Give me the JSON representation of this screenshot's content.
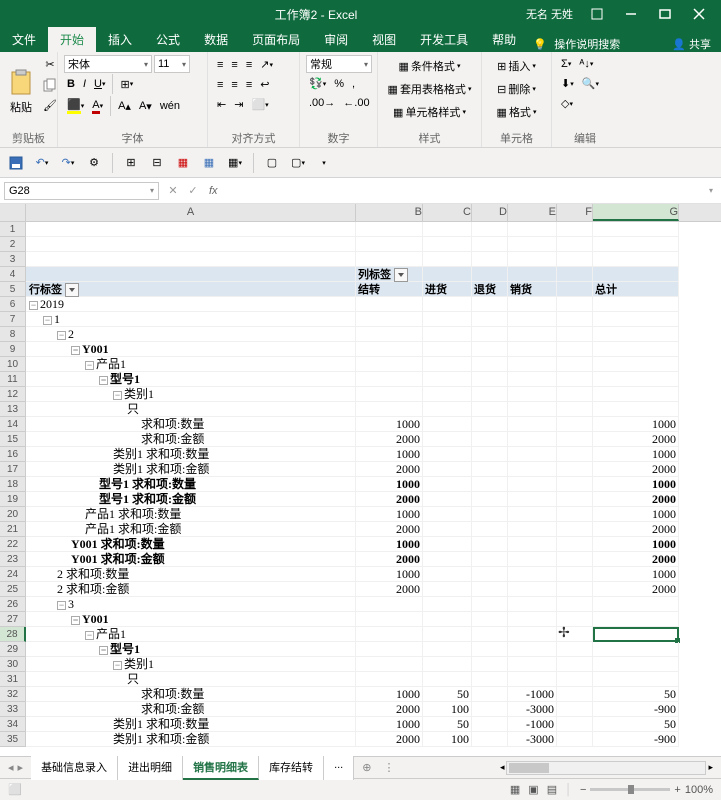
{
  "title": "工作簿2 - Excel",
  "user": "无名 无姓",
  "menu": {
    "file": "文件",
    "home": "开始",
    "insert": "插入",
    "formulas": "公式",
    "data": "数据",
    "pagelayout": "页面布局",
    "review": "审阅",
    "view": "视图",
    "developer": "开发工具",
    "help": "帮助",
    "tellme": "操作说明搜索",
    "share": "共享"
  },
  "ribbon": {
    "clipboard": {
      "label": "剪贴板",
      "paste": "粘贴"
    },
    "font": {
      "label": "字体",
      "name": "宋体",
      "size": "11"
    },
    "align": {
      "label": "对齐方式"
    },
    "number": {
      "label": "数字",
      "format": "常规"
    },
    "styles": {
      "label": "样式",
      "cond": "条件格式",
      "tbl": "套用表格格式",
      "cell": "单元格样式"
    },
    "cells": {
      "label": "单元格",
      "ins": "插入",
      "del": "删除",
      "fmt": "格式"
    },
    "edit": {
      "label": "编辑"
    }
  },
  "namebox": "G28",
  "cols": [
    "A",
    "B",
    "C",
    "D",
    "E",
    "F",
    "G"
  ],
  "pivot": {
    "colhdr": "列标签",
    "rowhdr": "行标签",
    "cols": [
      "结转",
      "进货",
      "退货",
      "销货",
      "总计"
    ]
  },
  "rows": [
    {
      "r": 1
    },
    {
      "r": 2
    },
    {
      "r": 3
    },
    {
      "r": 4,
      "hdr": 1,
      "a": "",
      "b": "列标签"
    },
    {
      "r": 5,
      "hdr": 1,
      "a": "行标签",
      "b": "结转",
      "c": "进货",
      "d": "退货",
      "e": "销货",
      "g": "总计"
    },
    {
      "r": 6,
      "a": "2019",
      "ind": 0,
      "tog": 1
    },
    {
      "r": 7,
      "a": "1",
      "ind": 2,
      "tog": 1
    },
    {
      "r": 8,
      "a": "2",
      "ind": 4,
      "tog": 1
    },
    {
      "r": 9,
      "a": "Y001",
      "ind": 6,
      "tog": 1,
      "bold": 1
    },
    {
      "r": 10,
      "a": "产品1",
      "ind": 8,
      "tog": 1
    },
    {
      "r": 11,
      "a": "型号1",
      "ind": 10,
      "tog": 1,
      "bold": 1
    },
    {
      "r": 12,
      "a": "类别1",
      "ind": 12,
      "tog": 1
    },
    {
      "r": 13,
      "a": "只",
      "ind": 14
    },
    {
      "r": 14,
      "a": "求和项:数量",
      "ind": 16,
      "b": "1000",
      "g": "1000"
    },
    {
      "r": 15,
      "a": "求和项:金额",
      "ind": 16,
      "b": "2000",
      "g": "2000"
    },
    {
      "r": 16,
      "a": "类别1 求和项:数量",
      "ind": 12,
      "b": "1000",
      "g": "1000"
    },
    {
      "r": 17,
      "a": "类别1 求和项:金额",
      "ind": 12,
      "b": "2000",
      "g": "2000"
    },
    {
      "r": 18,
      "a": "型号1 求和项:数量",
      "ind": 10,
      "bold": 1,
      "b": "1000",
      "g": "1000"
    },
    {
      "r": 19,
      "a": "型号1 求和项:金额",
      "ind": 10,
      "bold": 1,
      "b": "2000",
      "g": "2000"
    },
    {
      "r": 20,
      "a": "产品1 求和项:数量",
      "ind": 8,
      "b": "1000",
      "g": "1000"
    },
    {
      "r": 21,
      "a": "产品1 求和项:金额",
      "ind": 8,
      "b": "2000",
      "g": "2000"
    },
    {
      "r": 22,
      "a": "Y001 求和项:数量",
      "ind": 6,
      "bold": 1,
      "b": "1000",
      "g": "1000"
    },
    {
      "r": 23,
      "a": "Y001 求和项:金额",
      "ind": 6,
      "bold": 1,
      "b": "2000",
      "g": "2000"
    },
    {
      "r": 24,
      "a": "2 求和项:数量",
      "ind": 4,
      "b": "1000",
      "g": "1000"
    },
    {
      "r": 25,
      "a": "2 求和项:金额",
      "ind": 4,
      "b": "2000",
      "g": "2000"
    },
    {
      "r": 26,
      "a": "3",
      "ind": 4,
      "tog": 1
    },
    {
      "r": 27,
      "a": "Y001",
      "ind": 6,
      "tog": 1,
      "bold": 1
    },
    {
      "r": 28,
      "a": "产品1",
      "ind": 8,
      "tog": 1,
      "sel": 1
    },
    {
      "r": 29,
      "a": "型号1",
      "ind": 10,
      "tog": 1,
      "bold": 1
    },
    {
      "r": 30,
      "a": "类别1",
      "ind": 12,
      "tog": 1
    },
    {
      "r": 31,
      "a": "只",
      "ind": 14
    },
    {
      "r": 32,
      "a": "求和项:数量",
      "ind": 16,
      "b": "1000",
      "c": "50",
      "e": "-1000",
      "g": "50"
    },
    {
      "r": 33,
      "a": "求和项:金额",
      "ind": 16,
      "b": "2000",
      "c": "100",
      "e": "-3000",
      "g": "-900"
    },
    {
      "r": 34,
      "a": "类别1 求和项:数量",
      "ind": 12,
      "b": "1000",
      "c": "50",
      "e": "-1000",
      "g": "50"
    },
    {
      "r": 35,
      "a": "类别1 求和项:金额",
      "ind": 12,
      "b": "2000",
      "c": "100",
      "e": "-3000",
      "g": "-900"
    }
  ],
  "sheets": [
    "基础信息录入",
    "进出明细",
    "销售明细表",
    "库存结转",
    "..."
  ],
  "activesheet": 2,
  "zoom": "100%"
}
